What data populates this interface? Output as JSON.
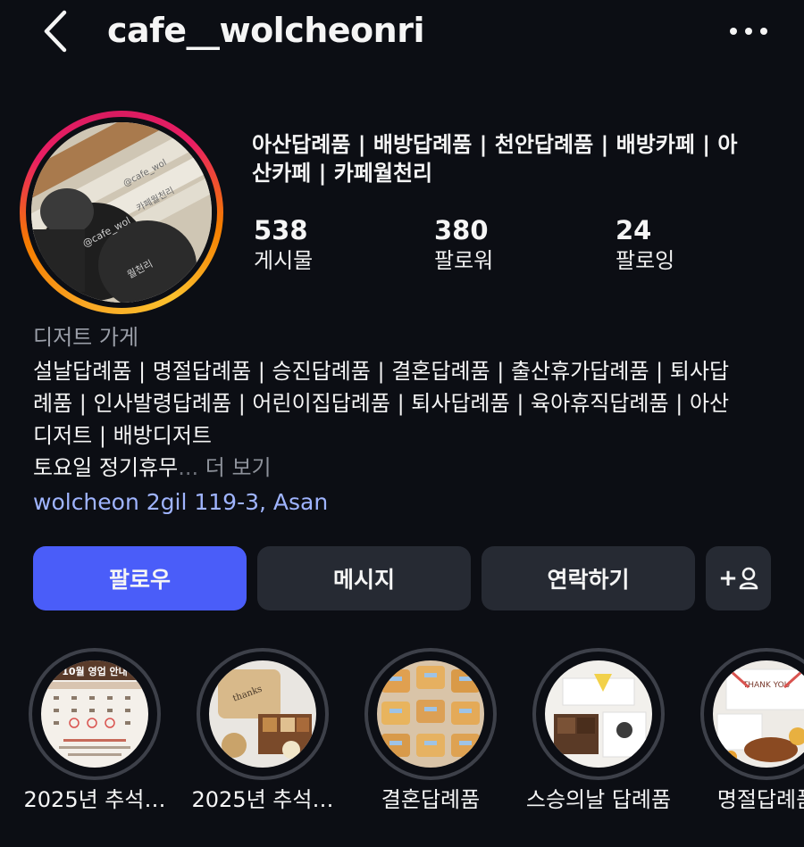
{
  "header": {
    "username": "cafe__wolcheonri",
    "back_icon": "chevron-left-icon",
    "more_icon": "more-horizontal-icon"
  },
  "profile": {
    "bio_title_line1": "아산답례품 | 배방답례품 | 천안답례품 | 배방카페 | 아",
    "bio_title_line2": "산카페 | 카페월천리",
    "stats": [
      {
        "value": "538",
        "label": "게시물"
      },
      {
        "value": "380",
        "label": "팔로워"
      },
      {
        "value": "24",
        "label": "팔로잉"
      }
    ],
    "category": "디저트 가게",
    "bio_lines": [
      "설날답례품 | 명절답례품 | 승진답례품 | 결혼답례품 | 출산휴가답례품 | 퇴사답",
      "례품 | 인사발령답례품 | 어린이집답례품 | 퇴사답례품 | 육아휴직답례품 | 아산",
      "디저트 | 배방디저트"
    ],
    "bio_last_line": "토요일 정기휴무",
    "bio_ellipsis": "...",
    "more_label": "더 보기",
    "address": "wolcheon 2gil 119-3, Asan",
    "ring_colors": [
      "#f9a825",
      "#e91e63",
      "#d81b60"
    ]
  },
  "actions": {
    "follow": "팔로우",
    "message": "메시지",
    "contact": "연락하기",
    "add_user_label": "+",
    "add_user_icon": "person-add-icon",
    "follow_color": "#4a5df9"
  },
  "highlights": [
    {
      "label": "2025년 추석…"
    },
    {
      "label": "2025년 추석…"
    },
    {
      "label": "결혼답례품"
    },
    {
      "label": "스승의날 답례품"
    },
    {
      "label": "명절답례품"
    }
  ],
  "highlight_thumb_texts": {
    "notice_title": "10월 영업 안내",
    "box_lid": "thanks",
    "card_text": "THANK YOU"
  }
}
